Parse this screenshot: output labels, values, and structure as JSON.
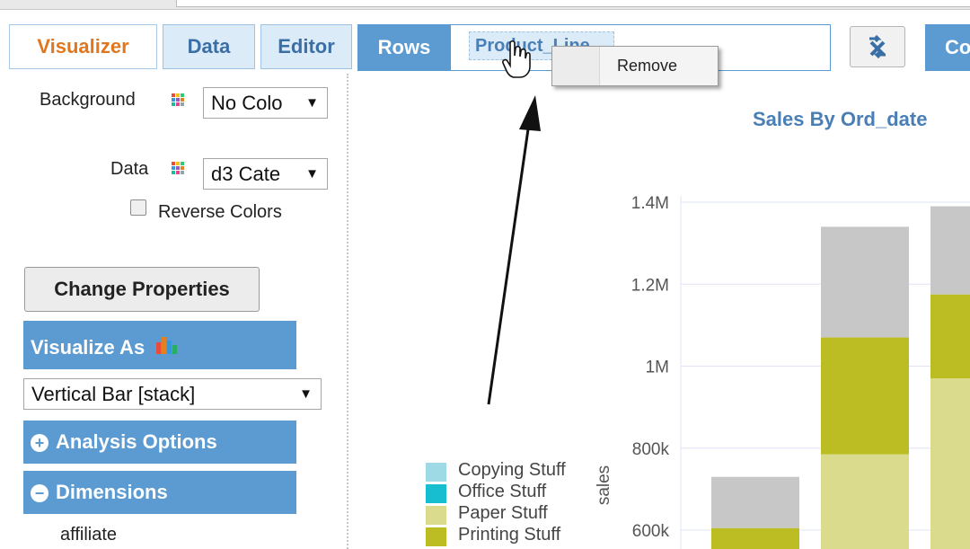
{
  "tabs": [
    {
      "label": "Visualizer",
      "active": true
    },
    {
      "label": "Data",
      "active": false
    },
    {
      "label": "Editor",
      "active": false
    }
  ],
  "rows": {
    "label": "Rows",
    "chip": "Product_Line"
  },
  "context_menu": {
    "items": [
      "Remove"
    ]
  },
  "toolbar": {
    "cut_label": "Co"
  },
  "properties": {
    "background_label": "Background",
    "background_value": "No Colo",
    "data_label": "Data",
    "data_value": "d3 Cate",
    "reverse_colors_label": "Reverse Colors",
    "reverse_colors_checked": false,
    "change_properties_button": "Change Properties"
  },
  "visualize": {
    "header": "Visualize As",
    "selected": "Vertical Bar [stack]"
  },
  "sections": {
    "analysis_options": "Analysis Options",
    "dimensions": "Dimensions"
  },
  "dimensions": [
    "affiliate"
  ],
  "colors": {
    "accent": "#5b9bd1",
    "tab_active_text": "#e0771e",
    "title": "#4a7fb5"
  },
  "chart_data": {
    "type": "bar",
    "stacked": true,
    "title": "Sales By Ord_date",
    "ylabel": "sales",
    "y_ticks": [
      "1.4M",
      "1.2M",
      "1M",
      "800k",
      "600k"
    ],
    "y_tick_values": [
      1400000,
      1200000,
      1000000,
      800000,
      600000
    ],
    "ylim": [
      560000,
      1420000
    ],
    "grid": true,
    "legend": [
      {
        "name": "Copying Stuff",
        "color": "#9edae5"
      },
      {
        "name": "Office Stuff",
        "color": "#17becf"
      },
      {
        "name": "Paper Stuff",
        "color": "#dbdb8d"
      },
      {
        "name": "Printing Stuff",
        "color": "#bcbd22"
      }
    ],
    "bars": [
      {
        "segments": [
          {
            "color": "#bcbd22",
            "from": 500000,
            "to": 605000
          },
          {
            "color": "#c7c7c7",
            "from": 605000,
            "to": 730000
          }
        ]
      },
      {
        "segments": [
          {
            "color": "#dbdb8d",
            "from": 500000,
            "to": 785000
          },
          {
            "color": "#bcbd22",
            "from": 785000,
            "to": 1070000
          },
          {
            "color": "#c7c7c7",
            "from": 1070000,
            "to": 1340000
          }
        ]
      },
      {
        "segments": [
          {
            "color": "#dbdb8d",
            "from": 500000,
            "to": 970000
          },
          {
            "color": "#bcbd22",
            "from": 970000,
            "to": 1175000
          },
          {
            "color": "#c7c7c7",
            "from": 1175000,
            "to": 1390000
          }
        ]
      }
    ]
  }
}
